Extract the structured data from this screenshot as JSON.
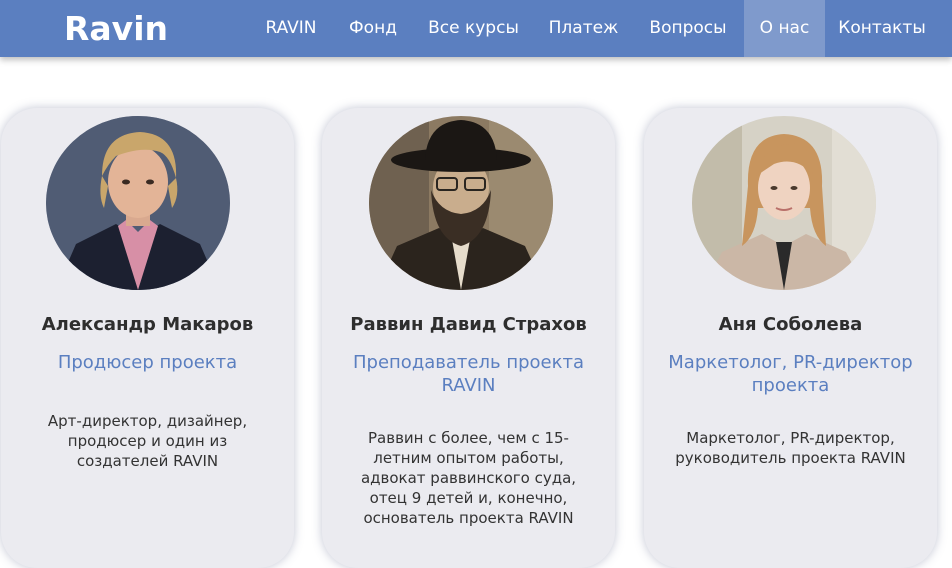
{
  "nav": {
    "logo": "Ravin",
    "items": [
      "RAVIN",
      "Фонд",
      "Все курсы",
      "Платеж",
      "Вопросы",
      "О нас",
      "Контакты"
    ],
    "active_index": 5
  },
  "team": [
    {
      "name": "Александр Макаров",
      "role": "Продюсер проекта",
      "bio": "Арт-директор, дизайнер, продюсер  и один из создателей RAVIN"
    },
    {
      "name": "Раввин Давид Страхов",
      "role": "Преподаватель проекта RAVIN",
      "bio": "Раввин с более, чем с 15-летним опытом работы, адвокат раввинского суда, отец 9 детей и, конечно, основатель проекта RAVIN"
    },
    {
      "name": "Аня Соболева",
      "role": "Маркетолог, PR-директор проекта",
      "bio": "Маркетолог, PR-директор, руководитель проекта RAVIN"
    }
  ],
  "colors": {
    "nav_bg": "#5b7fc0",
    "nav_active_bg": "#7f9acc",
    "card_bg": "#ebebf0",
    "role_text": "#5b7fc0"
  }
}
